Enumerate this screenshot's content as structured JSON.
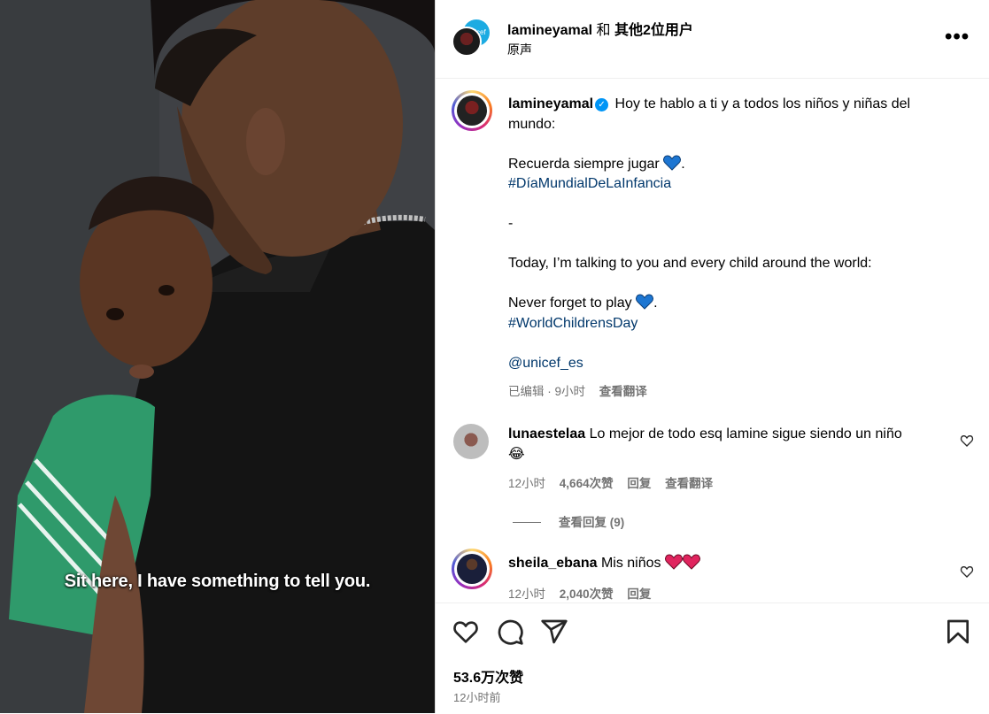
{
  "media": {
    "caption": "Sit here, I have something to tell you."
  },
  "header": {
    "author": "lamineyamal",
    "with": "和",
    "others": "其他2位用户",
    "audio": "原声",
    "more_label": "•••",
    "collab_avatar_text": "unicef"
  },
  "post": {
    "author": "lamineyamal",
    "verified_mark": "✓",
    "caption_line1": "Hoy te hablo a ti y a todos los niños y niñas del mundo:",
    "caption_line2": "Recuerda siempre jugar",
    "hashtag1": "#DíaMundialDeLaInfancia",
    "separator": "-",
    "caption_line3": "Today, I’m talking to you and every child around the world:",
    "caption_line4": "Never forget to play",
    "hashtag2": "#WorldChildrensDay",
    "mention": "@unicef_es",
    "edited": "已编辑 · 9小时",
    "translate": "查看翻译",
    "emoji": "💙"
  },
  "comments": [
    {
      "user": "lunaestelaa",
      "text": "Lo mejor de todo esq lamine sigue siendo un niño",
      "emoji": "😂",
      "time": "12小时",
      "likes": "4,664次赞",
      "reply": "回复",
      "translate": "查看翻译",
      "view_replies": "查看回复 (9)"
    },
    {
      "user": "sheila_ebana",
      "text": "Mis niños",
      "time": "12小时",
      "likes": "2,040次赞",
      "reply": "回复"
    }
  ],
  "footer": {
    "likes": "53.6万次赞",
    "time": "12小时前"
  },
  "colors": {
    "link": "#00376b",
    "meta": "#737373",
    "verified": "#0095f6",
    "heart": "#e0245e",
    "blue_heart": "#1d76d2"
  }
}
